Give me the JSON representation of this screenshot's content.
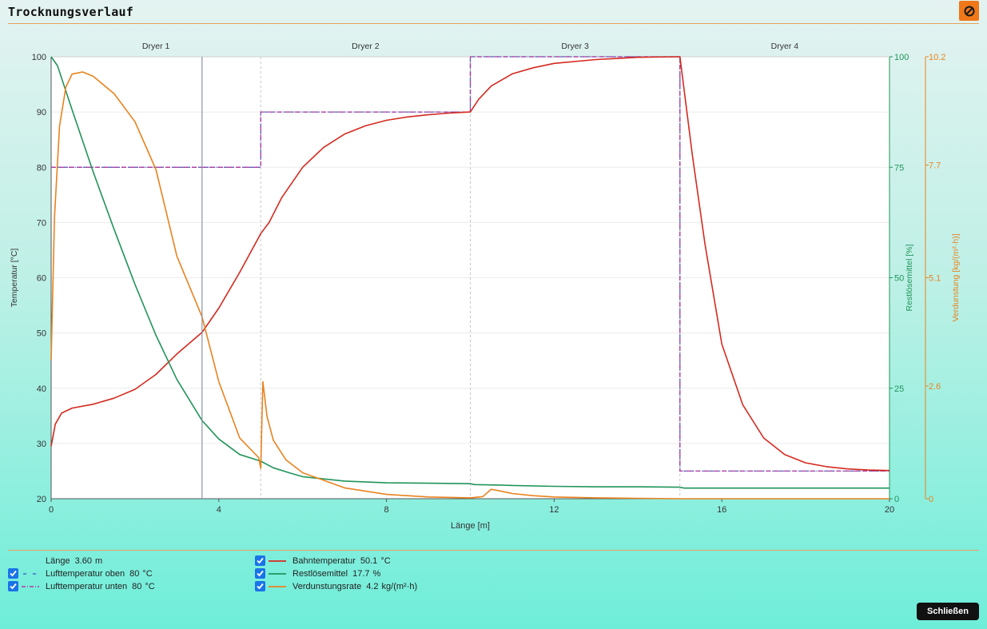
{
  "header": {
    "title": "Trocknungsverlauf",
    "logo_icon": "logo-icon"
  },
  "colors": {
    "accent": "#f07818",
    "bahn": "#d42a1f",
    "rest": "#21945a",
    "verd": "#e9821e",
    "luft_oben": "#3f6fc4",
    "luft_unten": "#b03a9e"
  },
  "chart_data": {
    "type": "line",
    "dryers": [
      "Dryer 1",
      "Dryer 2",
      "Dryer 3",
      "Dryer 4"
    ],
    "dryer_bounds": [
      0,
      5,
      10,
      15,
      20
    ],
    "xlabel": "Länge [m]",
    "xlim": [
      0,
      20
    ],
    "xticks": [
      "0",
      "4",
      "8",
      "12",
      "16",
      "20"
    ],
    "cursor_x": 3.6,
    "y_left": {
      "label": "Temperatur [°C]",
      "lim": [
        20,
        100
      ],
      "ticks": [
        "20",
        "30",
        "40",
        "50",
        "60",
        "70",
        "80",
        "90",
        "100"
      ]
    },
    "y_right1": {
      "label": "Restlösemittel [%]",
      "lim": [
        0,
        100
      ],
      "ticks": [
        "0",
        "25",
        "50",
        "75",
        "100"
      ]
    },
    "y_right2": {
      "label": "Verdunstung [kg/(m²·h)]",
      "lim": [
        0,
        10.2
      ],
      "ticks": [
        "0",
        "2.6",
        "5.1",
        "7.7",
        "10.2"
      ]
    },
    "series": [
      {
        "name": "Lufttemperatur oben",
        "axis": "left",
        "x": [
          0,
          5,
          5,
          10,
          10,
          15,
          15,
          20
        ],
        "y": [
          80,
          80,
          90,
          90,
          100,
          100,
          25,
          25
        ]
      },
      {
        "name": "Lufttemperatur unten",
        "axis": "left",
        "x": [
          0,
          5,
          5,
          10,
          10,
          15,
          15,
          20
        ],
        "y": [
          80,
          80,
          90,
          90,
          100,
          100,
          25,
          25
        ]
      },
      {
        "name": "Bahntemperatur",
        "axis": "left",
        "x": [
          0,
          0.1,
          0.25,
          0.5,
          1,
          1.5,
          2,
          2.5,
          3,
          3.6,
          4,
          4.5,
          5,
          5.2,
          5.5,
          6,
          6.5,
          7,
          7.5,
          8,
          8.5,
          9,
          9.5,
          10,
          10.2,
          10.5,
          11,
          11.5,
          12,
          13,
          14,
          15,
          15.05,
          15.3,
          15.6,
          16,
          16.5,
          17,
          17.5,
          18,
          18.5,
          19,
          19.5,
          20
        ],
        "y": [
          29.5,
          33.5,
          35.5,
          36.4,
          37.1,
          38.2,
          39.8,
          42.5,
          46.2,
          50.1,
          54.5,
          61,
          68,
          70,
          74.5,
          80,
          83.6,
          86,
          87.5,
          88.5,
          89.1,
          89.5,
          89.8,
          90,
          92.3,
          94.7,
          96.9,
          98,
          98.8,
          99.5,
          99.9,
          100,
          97,
          82,
          66,
          48,
          37,
          31,
          28,
          26.5,
          25.8,
          25.4,
          25.2,
          25.1
        ]
      },
      {
        "name": "Restlösemittel",
        "axis": "right1",
        "x": [
          0,
          0.15,
          0.5,
          1,
          1.5,
          2,
          2.5,
          3,
          3.6,
          4,
          4.5,
          5,
          5.3,
          5.7,
          6,
          7,
          8,
          9,
          10,
          10.1,
          10.7,
          11,
          12,
          13,
          14,
          15,
          15.1,
          16,
          17,
          18,
          19,
          20
        ],
        "y": [
          100,
          98,
          88,
          74,
          61,
          48.5,
          37,
          27,
          17.7,
          13.5,
          10,
          8.5,
          7,
          5.8,
          5,
          4,
          3.6,
          3.5,
          3.4,
          3.2,
          3.1,
          3,
          2.8,
          2.7,
          2.7,
          2.6,
          2.4,
          2.4,
          2.4,
          2.4,
          2.4,
          2.4
        ]
      },
      {
        "name": "Verdunstungsrate",
        "axis": "right2",
        "x": [
          0,
          0.08,
          0.2,
          0.35,
          0.5,
          0.75,
          1,
          1.5,
          2,
          2.5,
          3,
          3.6,
          4,
          4.5,
          4.95,
          5,
          5.05,
          5.15,
          5.3,
          5.6,
          6,
          7,
          8,
          9,
          10,
          10.3,
          10.5,
          10.7,
          11,
          11.5,
          12,
          13,
          14,
          15,
          15.05,
          16,
          17,
          18,
          19,
          20
        ],
        "y": [
          3.2,
          6.5,
          8.6,
          9.5,
          9.8,
          9.85,
          9.75,
          9.35,
          8.7,
          7.6,
          5.6,
          4.2,
          2.7,
          1.4,
          0.95,
          0.7,
          2.7,
          1.9,
          1.35,
          0.9,
          0.6,
          0.25,
          0.1,
          0.04,
          0.02,
          0.05,
          0.22,
          0.18,
          0.12,
          0.07,
          0.04,
          0.02,
          0.01,
          0,
          0,
          0,
          0,
          0,
          0,
          0
        ]
      }
    ]
  },
  "legend": {
    "length": {
      "label": "Länge",
      "value": "3.60",
      "unit": "m"
    },
    "left_items": [
      {
        "label": "Lufttemperatur oben",
        "value": "80",
        "unit": "°C"
      },
      {
        "label": "Lufttemperatur unten",
        "value": "80",
        "unit": "°C"
      }
    ],
    "right_items": [
      {
        "label": "Bahntemperatur",
        "value": "50.1",
        "unit": "°C"
      },
      {
        "label": "Restlösemittel",
        "value": "17.7",
        "unit": "%"
      },
      {
        "label": "Verdunstungsrate",
        "value": "4.2",
        "unit": "kg/(m²·h)"
      }
    ]
  },
  "footer": {
    "close_label": "Schließen"
  }
}
